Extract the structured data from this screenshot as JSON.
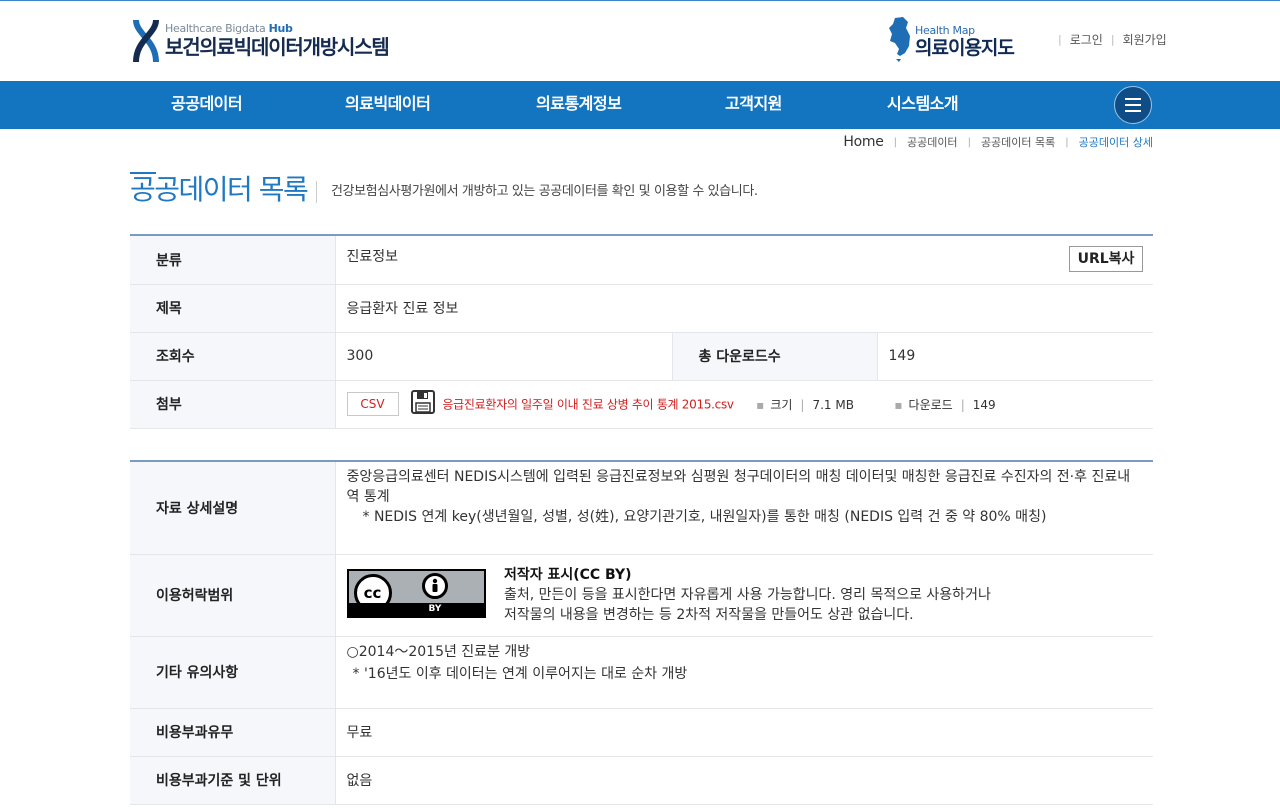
{
  "header": {
    "logo_sub_prefix": "Healthcare Bigdata ",
    "logo_sub_hub": "Hub",
    "logo_main": "보건의료빅데이터개방시스템",
    "healthmap_sub": "Health Map",
    "healthmap_main": "의료이용지도",
    "login": "로그인",
    "signup": "회원가입"
  },
  "nav": {
    "items": [
      "공공데이터",
      "의료빅데이터",
      "의료통계정보",
      "고객지원",
      "시스템소개"
    ]
  },
  "breadcrumb": {
    "home": "Home",
    "items": [
      "공공데이터",
      "공공데이터 목록",
      "공공데이터 상세"
    ]
  },
  "page": {
    "title": "공공데이터 목록",
    "desc": "건강보험심사평가원에서 개방하고 있는 공공데이터를 확인 및 이용할 수 있습니다."
  },
  "info": {
    "category_label": "분류",
    "category_value": "진료정보",
    "url_copy": "URL복사",
    "title_label": "제목",
    "title_value": "응급환자 진료 정보",
    "views_label": "조회수",
    "views_value": "300",
    "downloads_label": "총 다운로드수",
    "downloads_value": "149",
    "attach_label": "첨부",
    "attach_type": "CSV",
    "attach_filename": "응급진료환자의 일주일 이내 진료 상병 추이 통계 2015.csv",
    "size_label": "크기",
    "size_value": "7.1 MB",
    "dl_label": "다운로드",
    "dl_value": "149"
  },
  "details": {
    "desc_label": "자료 상세설명",
    "desc_line1": "중앙응급의료센터 NEDIS시스템에 입력된 응급진료정보와 심평원 청구데이터의 매칭 데이터및 매칭한 응급진료 수진자의 전·후 진료내역 통계",
    "desc_line2": "* NEDIS 연계 key(생년월일, 성별, 성(姓), 요양기관기호, 내원일자)를 통한 매칭 (NEDIS 입력 건 중 약 80% 매칭)",
    "license_label": "이용허락범위",
    "license_badge": "BY",
    "license_title": "저작자 표시(CC BY)",
    "license_line1": "출처, 만든이 등을 표시한다면 자유롭게 사용 가능합니다. 영리 목적으로 사용하거나",
    "license_line2": "저작물의 내용을 변경하는 등 2차적 저작물을 만들어도 상관 없습니다.",
    "notes_label": "기타 유의사항",
    "notes_line1": "○2014～2015년 진료분 개방",
    "notes_line2": "* '16년도 이후 데이터는 연계 이루어지는 대로 순차 개방",
    "fee_label": "비용부과유무",
    "fee_value": "무료",
    "fee_basis_label": "비용부과기준 및 단위",
    "fee_basis_value": "없음"
  },
  "colors": {
    "brand_blue": "#1374c0",
    "title_blue": "#1f78c2",
    "attach_red": "#d11f1f"
  }
}
